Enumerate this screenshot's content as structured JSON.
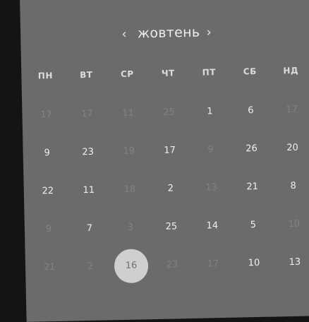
{
  "calendar": {
    "month_label": "жовтень",
    "prev_glyph": "‹",
    "next_glyph": "›",
    "weekdays": [
      "ПН",
      "ВТ",
      "СР",
      "ЧТ",
      "ПТ",
      "СБ",
      "НД"
    ],
    "rows": [
      [
        {
          "d": "17",
          "m": "out"
        },
        {
          "d": "17",
          "m": "out"
        },
        {
          "d": "11",
          "m": "out"
        },
        {
          "d": "25",
          "m": "out"
        },
        {
          "d": "1",
          "m": "in"
        },
        {
          "d": "6",
          "m": "in"
        },
        {
          "d": "17",
          "m": "out"
        }
      ],
      [
        {
          "d": "9",
          "m": "in"
        },
        {
          "d": "23",
          "m": "in"
        },
        {
          "d": "19",
          "m": "out"
        },
        {
          "d": "17",
          "m": "in"
        },
        {
          "d": "9",
          "m": "out"
        },
        {
          "d": "26",
          "m": "in"
        },
        {
          "d": "20",
          "m": "in"
        }
      ],
      [
        {
          "d": "22",
          "m": "in"
        },
        {
          "d": "11",
          "m": "in"
        },
        {
          "d": "18",
          "m": "out"
        },
        {
          "d": "2",
          "m": "in"
        },
        {
          "d": "13",
          "m": "out"
        },
        {
          "d": "21",
          "m": "in"
        },
        {
          "d": "8",
          "m": "in"
        }
      ],
      [
        {
          "d": "9",
          "m": "out"
        },
        {
          "d": "7",
          "m": "in"
        },
        {
          "d": "3",
          "m": "out"
        },
        {
          "d": "25",
          "m": "in"
        },
        {
          "d": "14",
          "m": "in"
        },
        {
          "d": "5",
          "m": "in"
        },
        {
          "d": "10",
          "m": "out"
        }
      ],
      [
        {
          "d": "21",
          "m": "out"
        },
        {
          "d": "2",
          "m": "out"
        },
        {
          "d": "16",
          "m": "sel"
        },
        {
          "d": "23",
          "m": "out"
        },
        {
          "d": "17",
          "m": "out"
        },
        {
          "d": "10",
          "m": "in"
        },
        {
          "d": "13",
          "m": "in"
        }
      ]
    ]
  }
}
